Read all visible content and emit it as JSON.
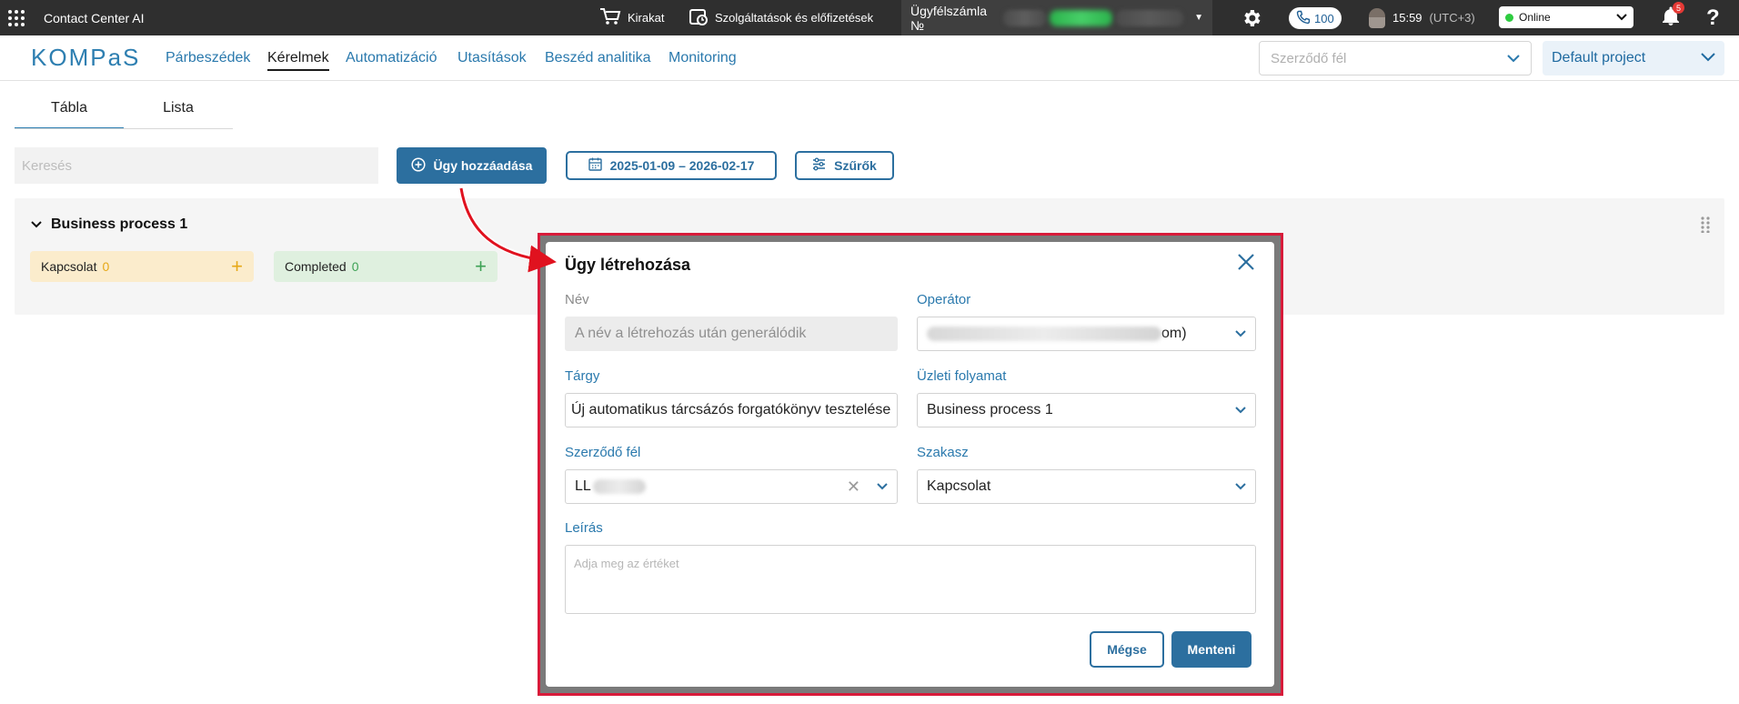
{
  "topbar": {
    "app_title": "Contact Center AI",
    "storefront_label": "Kirakat",
    "services_label": "Szolgáltatások és előfizetések",
    "account_label": "Ügyfélszámla №",
    "calls_count": "100",
    "time": "15:59",
    "timezone": "(UTC+3)",
    "status": "Online",
    "notifications_count": "5",
    "help_label": "?"
  },
  "nav": {
    "logo": "KOMPaS",
    "links": [
      "Párbeszédek",
      "Kérelmek",
      "Automatizáció",
      "Utasítások",
      "Beszéd analitika",
      "Monitoring"
    ],
    "active_index": 1,
    "party_placeholder": "Szerződő fél",
    "project": "Default project"
  },
  "view_tabs": [
    "Tábla",
    "Lista"
  ],
  "toolbar": {
    "search_placeholder": "Keresés",
    "add_case_label": "Ügy hozzáadása",
    "date_range": "2025-01-09 – 2026-02-17",
    "filters_label": "Szűrők"
  },
  "board": {
    "process_title": "Business process 1",
    "stages": [
      {
        "name": "Kapcsolat",
        "count": "0",
        "color": "#fbeccc"
      },
      {
        "name": "Completed",
        "count": "0",
        "color": "#dff0df"
      }
    ]
  },
  "dialog": {
    "title": "Ügy létrehozása",
    "name_label": "Név",
    "name_value": "A név a létrehozás után generálódik",
    "operator_label": "Operátor",
    "operator_suffix": "om)",
    "subject_label": "Tárgy",
    "subject_value": "Új automatikus tárcsázós forgatókönyv tesztelése",
    "business_process_label": "Üzleti folyamat",
    "business_process_value": "Business process 1",
    "party_label": "Szerződő fél",
    "party_value": "LL",
    "stage_label": "Szakasz",
    "stage_value": "Kapcsolat",
    "description_label": "Leírás",
    "description_placeholder": "Adja meg az értéket",
    "cancel_label": "Mégse",
    "save_label": "Menteni"
  },
  "colors": {
    "topbar": "#2f2f2f",
    "accent": "#2c6f9f",
    "link": "#2a79ad",
    "annotation": "#d81b3a"
  }
}
